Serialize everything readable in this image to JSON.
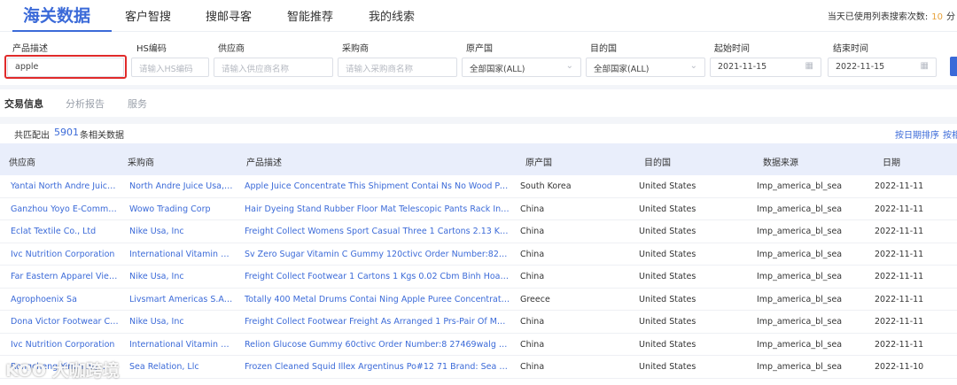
{
  "nav": {
    "items": [
      {
        "label": "海关数据",
        "active": true
      },
      {
        "label": "客户智搜"
      },
      {
        "label": "搜邮寻客"
      },
      {
        "label": "智能推荐"
      },
      {
        "label": "我的线索"
      }
    ],
    "quota_label": "当天已使用列表搜索次数:",
    "quota_value": "10",
    "quota_suffix": "分"
  },
  "filters": {
    "product": {
      "label": "产品描述",
      "value": "apple"
    },
    "hs": {
      "label": "HS编码",
      "placeholder": "请输入HS编码"
    },
    "supplier": {
      "label": "供应商",
      "placeholder": "请输入供应商名称"
    },
    "buyer": {
      "label": "采购商",
      "placeholder": "请输入采购商名称"
    },
    "origin": {
      "label": "原产国",
      "value": "全部国家(ALL)"
    },
    "destination": {
      "label": "目的国",
      "value": "全部国家(ALL)"
    },
    "start": {
      "label": "起始时间",
      "value": "2021-11-15"
    },
    "end": {
      "label": "结束时间",
      "value": "2022-11-15"
    }
  },
  "subtabs": [
    "交易信息",
    "分析报告",
    "服务"
  ],
  "summary": {
    "prefix": "共匹配出",
    "count": "5901",
    "suffix": "条相关数据",
    "sort_date": "按日期排序",
    "sort_more": "按相"
  },
  "table": {
    "headers": [
      "供应商",
      "采购商",
      "产品描述",
      "原产国",
      "目的国",
      "数据来源",
      "日期"
    ],
    "rows": [
      [
        "Yantai North Andre Juice C...",
        "North Andre Juice Usa, Inc",
        "Apple Juice Concentrate This Shipment Contai Ns No Wood Packing ...",
        "South Korea",
        "United States",
        "Imp_america_bl_sea",
        "2022-11-11"
      ],
      [
        "Ganzhou Yoyo E-Commerc...",
        "Wowo Trading Corp",
        "Hair Dyeing Stand Rubber Floor Mat Telescopic Pants Rack Instrument ...",
        "China",
        "United States",
        "Imp_america_bl_sea",
        "2022-11-11"
      ],
      [
        "Eclat Textile Co., Ltd",
        "Nike Usa, Inc",
        "Freight Collect Womens Sport Casual Three 1 Cartons 2.13 Kgs 0.04 C...",
        "China",
        "United States",
        "Imp_america_bl_sea",
        "2022-11-11"
      ],
      [
        "Ivc Nutrition Corporation",
        "International Vitamin Corp...",
        "Sv Zero Sugar Vitamin C Gummy 120ctivc Order Number:827457walg ...",
        "China",
        "United States",
        "Imp_america_bl_sea",
        "2022-11-11"
      ],
      [
        "Far Eastern Apparel Vietna...",
        "Nike Usa, Inc",
        "Freight Collect Footwear 1 Cartons 1 Kgs 0.02 Cbm Binh Hoa Ward.Th...",
        "China",
        "United States",
        "Imp_america_bl_sea",
        "2022-11-11"
      ],
      [
        "Agrophoenix Sa",
        "Livsmart Americas S.A. De ...",
        "Totally 400 Metal Drums Contai Ning Apple Puree Concentrated 30/32...",
        "Greece",
        "United States",
        "Imp_america_bl_sea",
        "2022-11-11"
      ],
      [
        "Dona Victor Footwear Co., ...",
        "Nike Usa, Inc",
        "Freight Collect Footwear Freight As Arranged 1 Prs-Pair Of Men'S Foot...",
        "China",
        "United States",
        "Imp_america_bl_sea",
        "2022-11-11"
      ],
      [
        "Ivc Nutrition Corporation",
        "International Vitamin Corp...",
        "Relion Glucose Gummy 60ctivc Order Number:8 27469walg Apple Cid...",
        "China",
        "United States",
        "Imp_america_bl_sea",
        "2022-11-11"
      ],
      [
        "Rongcheng Yimin Ag...",
        "Sea Relation, Llc",
        "Frozen Cleaned Squid Illex Argentinus Po#12 71 Brand: Sea Apple Pro...",
        "China",
        "United States",
        "Imp_america_bl_sea",
        "2022-11-10"
      ]
    ]
  },
  "watermark": "KOO 大咖跨境"
}
